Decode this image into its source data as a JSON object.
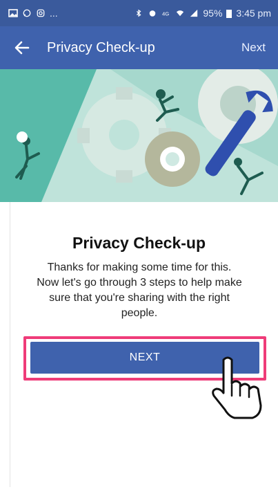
{
  "status_bar": {
    "left_icons": [
      "gallery-icon",
      "whatsapp-icon",
      "instagram-icon"
    ],
    "ellipsis": "...",
    "battery": "95%",
    "time": "3:45 pm"
  },
  "app_bar": {
    "title": "Privacy Check-up",
    "next_label": "Next",
    "back_icon": "arrow-left-icon"
  },
  "content": {
    "title": "Privacy Check-up",
    "description": "Thanks for making some time for this. Now let's go through 3 steps to help make sure that you're sharing with the right people.",
    "next_button_label": "NEXT"
  },
  "colors": {
    "brand_blue": "#3f62ad",
    "status_blue": "#3a5a9c",
    "highlight_pink": "#ef3c79",
    "hero_bg": "#cfe9e2"
  }
}
